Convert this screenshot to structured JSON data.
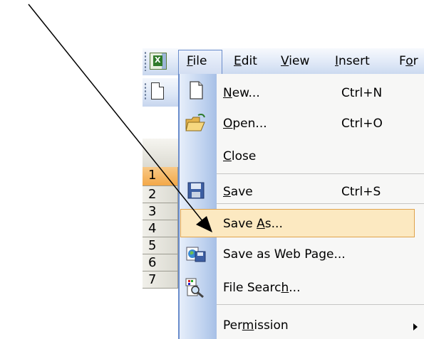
{
  "menubar": {
    "items": [
      {
        "label": "File",
        "mnemonic": "F",
        "rest": "ile"
      },
      {
        "label": "Edit",
        "mnemonic": "E",
        "rest": "dit"
      },
      {
        "label": "View",
        "mnemonic": "V",
        "rest": "iew"
      },
      {
        "label": "Insert",
        "mnemonic": "I",
        "rest": "nsert"
      },
      {
        "label": "Format",
        "visible_text": "For",
        "mnemonic": "o",
        "pre": "F",
        "rest": "r"
      }
    ]
  },
  "row_headers": [
    "1",
    "2",
    "3",
    "4",
    "5",
    "6",
    "7"
  ],
  "file_menu": {
    "new": {
      "pre": "",
      "mn": "N",
      "post": "ew...",
      "shortcut": "Ctrl+N"
    },
    "open": {
      "pre": "",
      "mn": "O",
      "post": "pen...",
      "shortcut": "Ctrl+O"
    },
    "close": {
      "pre": "",
      "mn": "C",
      "post": "lose"
    },
    "save": {
      "pre": "",
      "mn": "S",
      "post": "ave",
      "shortcut": "Ctrl+S"
    },
    "save_as": {
      "pre": "Save ",
      "mn": "A",
      "post": "s..."
    },
    "save_web": {
      "pre": "Save as Web Pa",
      "mn": "g",
      "post": "e..."
    },
    "file_search": {
      "pre": "File Searc",
      "mn": "h",
      "post": "..."
    },
    "permission": {
      "pre": "Per",
      "mn": "m",
      "post": "ission"
    }
  },
  "colors": {
    "menu_highlight": "#fce9c1",
    "menu_highlight_border": "#e0a34c",
    "selected_row_header": "#f3a848"
  },
  "icons": [
    "excel-app-icon",
    "new-document-icon",
    "open-folder-icon",
    "floppy-disk-icon",
    "web-page-icon",
    "file-search-icon",
    "submenu-arrow-icon",
    "annotation-arrow"
  ]
}
